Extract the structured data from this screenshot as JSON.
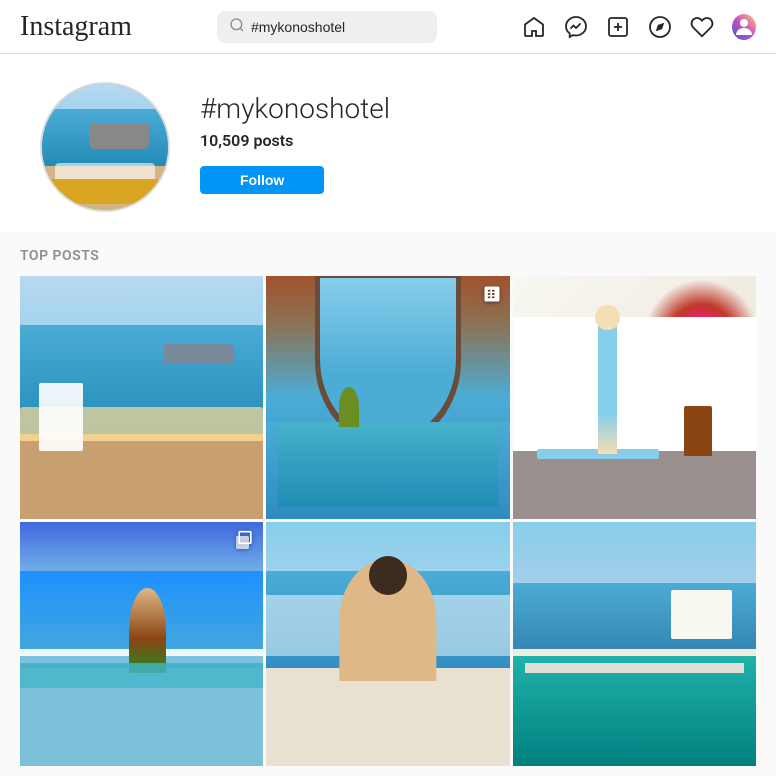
{
  "header": {
    "logo": "Instagram",
    "search": {
      "placeholder": "#mykonoshotel",
      "value": "#mykonoshotel"
    },
    "icons": {
      "home": "home-icon",
      "messenger": "messenger-icon",
      "add": "add-icon",
      "explore": "explore-icon",
      "heart": "heart-icon"
    }
  },
  "profile": {
    "hashtag": "#mykonoshotel",
    "posts_count": "10,509",
    "posts_label": "posts",
    "follow_button": "Follow"
  },
  "top_posts": {
    "section_label": "Top posts"
  }
}
